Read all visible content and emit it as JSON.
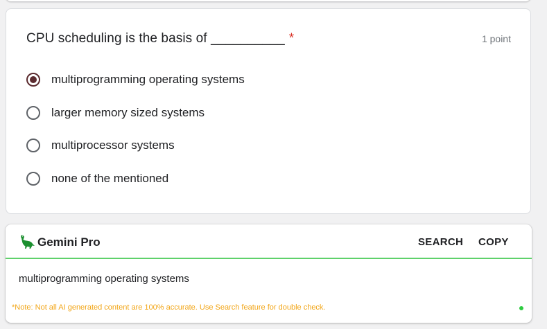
{
  "question": {
    "title": "CPU scheduling is the basis of __________",
    "required_mark": "*",
    "points": "1 point",
    "options": [
      {
        "label": "multiprogramming operating systems",
        "selected": true
      },
      {
        "label": "larger memory sized systems",
        "selected": false
      },
      {
        "label": "multiprocessor systems",
        "selected": false
      },
      {
        "label": "none of the mentioned",
        "selected": false
      }
    ]
  },
  "gemini": {
    "logo_icon": "dinosaur-icon",
    "title": "Gemini Pro",
    "search_label": "SEARCH",
    "copy_label": "COPY",
    "answer": "multiprogramming operating systems",
    "note": "*Note: Not all AI generated content are 100% accurate. Use Search feature for double check.",
    "accent_color": "#5fd16b",
    "note_color": "#f2a516",
    "status_color": "#2ecc40"
  },
  "colors": {
    "radio_selected": "#5b2b2f",
    "required": "#d93025"
  }
}
